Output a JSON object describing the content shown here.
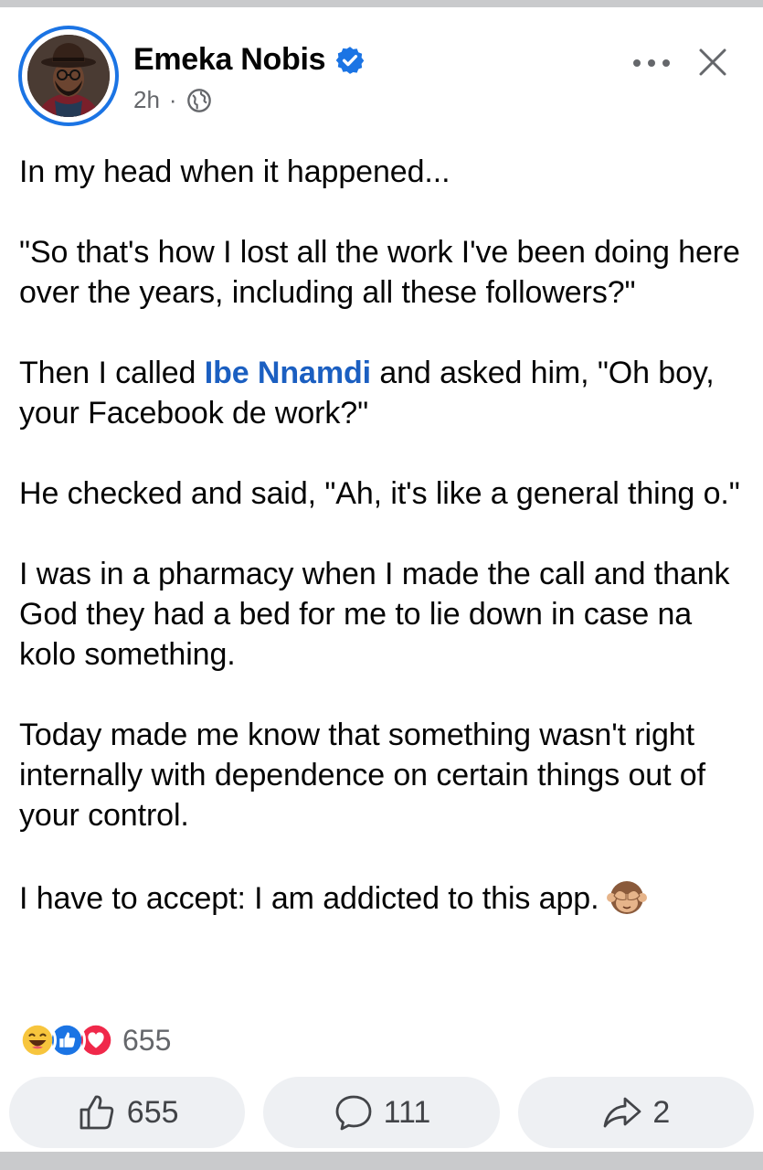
{
  "post": {
    "author": "Emeka Nobis",
    "time": "2h",
    "separator": "·",
    "paragraphs": {
      "p1": "In my head when it happened...",
      "p2": "\"So that's how I lost all the work I've been doing here over the years, including all these followers?\"",
      "p3_before": "Then I called ",
      "p3_mention": "Ibe Nnamdi",
      "p3_after": " and asked him, \"Oh boy, your Facebook de work?\"",
      "p4": "He checked and said, \"Ah, it's like a general thing o.\"",
      "p5": "I was in a pharmacy when I made the call and thank God they had a bed for me to lie down in case na kolo something.",
      "p6": "Today made me know that something wasn't right internally with dependence on certain things out of your control.",
      "p7": "I have to accept: I am addicted to this app."
    },
    "inline_emoji": "see-no-evil-monkey-icon"
  },
  "reactions": {
    "icons": [
      "laugh-icon",
      "like-icon",
      "love-icon"
    ],
    "count": "655"
  },
  "actions": {
    "like_count": "655",
    "comment_count": "111",
    "share_count": "2"
  },
  "colors": {
    "accent": "#1b74e4",
    "mention": "#1b5fc1",
    "button_bg": "#eef0f3",
    "secondary_text": "#65676b"
  }
}
